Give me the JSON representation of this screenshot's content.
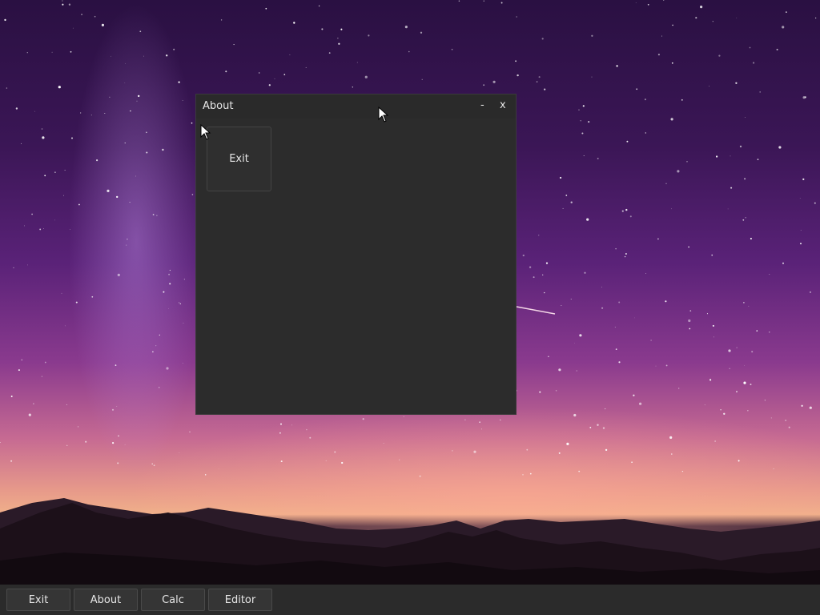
{
  "window": {
    "title": "About",
    "minimize_label": "-",
    "close_label": "x",
    "exit_label": "Exit"
  },
  "taskbar": {
    "items": [
      {
        "label": "Exit"
      },
      {
        "label": "About"
      },
      {
        "label": "Calc"
      },
      {
        "label": "Editor"
      }
    ]
  },
  "colors": {
    "window_bg": "#2c2c2c",
    "taskbar_bg": "#2b2b2b",
    "text": "#e6e6e6"
  }
}
